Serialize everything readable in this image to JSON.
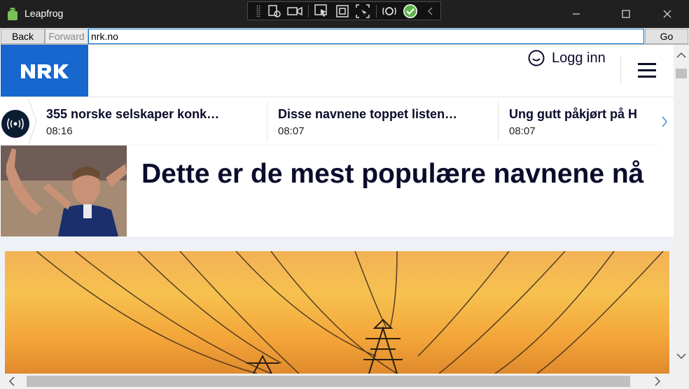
{
  "window": {
    "title": "Leapfrog",
    "minimize_glyph": "—",
    "maximize_glyph": "☐",
    "close_glyph": "✕"
  },
  "navbar": {
    "back_label": "Back",
    "forward_label": "Forward",
    "url": "nrk.no",
    "go_label": "Go"
  },
  "page": {
    "logo_text": "NRK",
    "login_label": "Logg inn",
    "ticker": [
      {
        "title": "355 norske selskaper konk…",
        "time": "08:16"
      },
      {
        "title": "Disse navnene toppet listen…",
        "time": "08:07"
      },
      {
        "title": "Ung gutt påkjørt på H",
        "time": "08:07"
      }
    ],
    "headline": "Dette er de mest populære navnene nå"
  },
  "icons": {
    "live": "broadcast-icon",
    "account": "smiley-user-icon",
    "menu": "hamburger-menu-icon"
  },
  "colors": {
    "nrk_blue": "#1767ce",
    "text_dark": "#0b0b2b",
    "titlebar": "#202020"
  }
}
